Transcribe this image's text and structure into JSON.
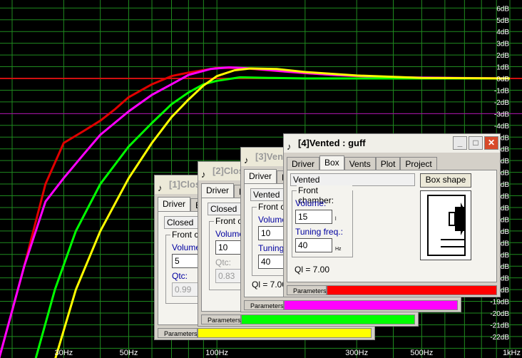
{
  "plot": {
    "db_labels": [
      "6dB",
      "5dB",
      "4dB",
      "3dB",
      "2dB",
      "1dB",
      "0dB",
      "-1dB",
      "-2dB",
      "-3dB",
      "-4dB",
      "-5dB",
      "-6dB",
      "-7dB",
      "-8dB",
      "-9dB",
      "-10dB",
      "-11dB",
      "-12dB",
      "-13dB",
      "-14dB",
      "-15dB",
      "-16dB",
      "-17dB",
      "-18dB",
      "-19dB",
      "-20dB",
      "-21dB",
      "-22dB"
    ],
    "freq_labels": [
      {
        "text": "30Hz",
        "f": 30
      },
      {
        "text": "50Hz",
        "f": 50
      },
      {
        "text": "100Hz",
        "f": 100
      },
      {
        "text": "300Hz",
        "f": 300
      },
      {
        "text": "500Hz",
        "f": 500
      },
      {
        "text": "1kHz",
        "f": 1000
      }
    ],
    "grid_color": "#1f8a1f",
    "ref_line_color": "#d01010",
    "minus3_line_color": "#b000b0",
    "curves": [
      {
        "name": "vented",
        "color": "#e00000",
        "points": [
          [
            18,
            -24
          ],
          [
            22,
            -16
          ],
          [
            26,
            -9
          ],
          [
            30,
            -5.5
          ],
          [
            35,
            -4.5
          ],
          [
            40,
            -3.6
          ],
          [
            45,
            -2.6
          ],
          [
            50,
            -1.6
          ],
          [
            60,
            -0.5
          ],
          [
            70,
            0.2
          ],
          [
            80,
            0.5
          ],
          [
            100,
            0.9
          ],
          [
            120,
            0.9
          ],
          [
            150,
            0.7
          ],
          [
            200,
            0.45
          ],
          [
            300,
            0.2
          ],
          [
            500,
            0.05
          ],
          [
            1000,
            0
          ]
        ]
      },
      {
        "name": "magenta",
        "color": "#ff00ff",
        "points": [
          [
            18,
            -24
          ],
          [
            22,
            -16
          ],
          [
            26,
            -10.5
          ],
          [
            30,
            -8.5
          ],
          [
            35,
            -6.5
          ],
          [
            40,
            -4.8
          ],
          [
            50,
            -2.8
          ],
          [
            60,
            -1.4
          ],
          [
            70,
            -0.5
          ],
          [
            80,
            0.3
          ],
          [
            95,
            0.8
          ],
          [
            110,
            0.95
          ],
          [
            130,
            0.85
          ],
          [
            170,
            0.6
          ],
          [
            250,
            0.3
          ],
          [
            400,
            0.1
          ],
          [
            1000,
            0
          ]
        ]
      },
      {
        "name": "green",
        "color": "#00ff00",
        "points": [
          [
            24,
            -24
          ],
          [
            28,
            -18
          ],
          [
            33,
            -13
          ],
          [
            40,
            -9
          ],
          [
            50,
            -5.8
          ],
          [
            60,
            -3.8
          ],
          [
            70,
            -2.2
          ],
          [
            80,
            -1.2
          ],
          [
            90,
            -0.5
          ],
          [
            100,
            -0.2
          ],
          [
            120,
            0.1
          ],
          [
            150,
            0.05
          ],
          [
            200,
            0
          ],
          [
            1000,
            0
          ]
        ]
      },
      {
        "name": "yellow",
        "color": "#ffff00",
        "points": [
          [
            28,
            -24
          ],
          [
            33,
            -18
          ],
          [
            40,
            -13
          ],
          [
            50,
            -8.5
          ],
          [
            60,
            -5.5
          ],
          [
            70,
            -3.3
          ],
          [
            80,
            -1.8
          ],
          [
            90,
            -0.6
          ],
          [
            100,
            0.2
          ],
          [
            115,
            0.7
          ],
          [
            130,
            0.85
          ],
          [
            160,
            0.8
          ],
          [
            200,
            0.55
          ],
          [
            300,
            0.25
          ],
          [
            500,
            0.05
          ],
          [
            1000,
            0
          ]
        ]
      }
    ]
  },
  "windows": [
    {
      "title": "[1]Closed : guff",
      "tabs": [
        "Driver",
        "Box"
      ],
      "type": "Closed",
      "group_title": "Front chamber:",
      "volume_label": "Volume:",
      "volume": "5",
      "qtc_label": "Qtc:",
      "qtc": "0.99",
      "param_label": "Parameters",
      "param_color": "#ffff00"
    },
    {
      "title": "[2]Closed : guff",
      "tabs": [
        "Driver",
        "Box"
      ],
      "type": "Closed",
      "group_title": "Front chamber:",
      "volume_label": "Volume:",
      "volume": "10",
      "qtc_label": "Qtc:",
      "qtc": "0.83",
      "param_label": "Parameters",
      "param_color": "#00ff00"
    },
    {
      "title": "[3]Vented : guff",
      "tabs": [
        "Driver",
        "Box"
      ],
      "type": "Vented",
      "group_title": "Front chamber:",
      "volume_label": "Volume:",
      "volume": "10",
      "tuning_label": "Tuning freq.:",
      "tuning": "40",
      "ql": "Ql = 7.00",
      "param_label": "Parameters",
      "param_color": "#ff00ff"
    },
    {
      "title": "[4]Vented : guff",
      "tabs": [
        "Driver",
        "Box",
        "Vents",
        "Plot",
        "Project"
      ],
      "type": "Vented",
      "box_shape": "Box shape",
      "group_title": "Front chamber:",
      "volume_label": "Volume:",
      "volume": "15",
      "volume_unit": "l",
      "tuning_label": "Tuning freq.:",
      "tuning": "40",
      "tuning_unit": "Hz",
      "ql": "Ql = 7.00",
      "param_label": "Parameters",
      "param_color": "#ff0000",
      "controls": {
        "min": "_",
        "max": "□",
        "close": "✕"
      }
    }
  ]
}
